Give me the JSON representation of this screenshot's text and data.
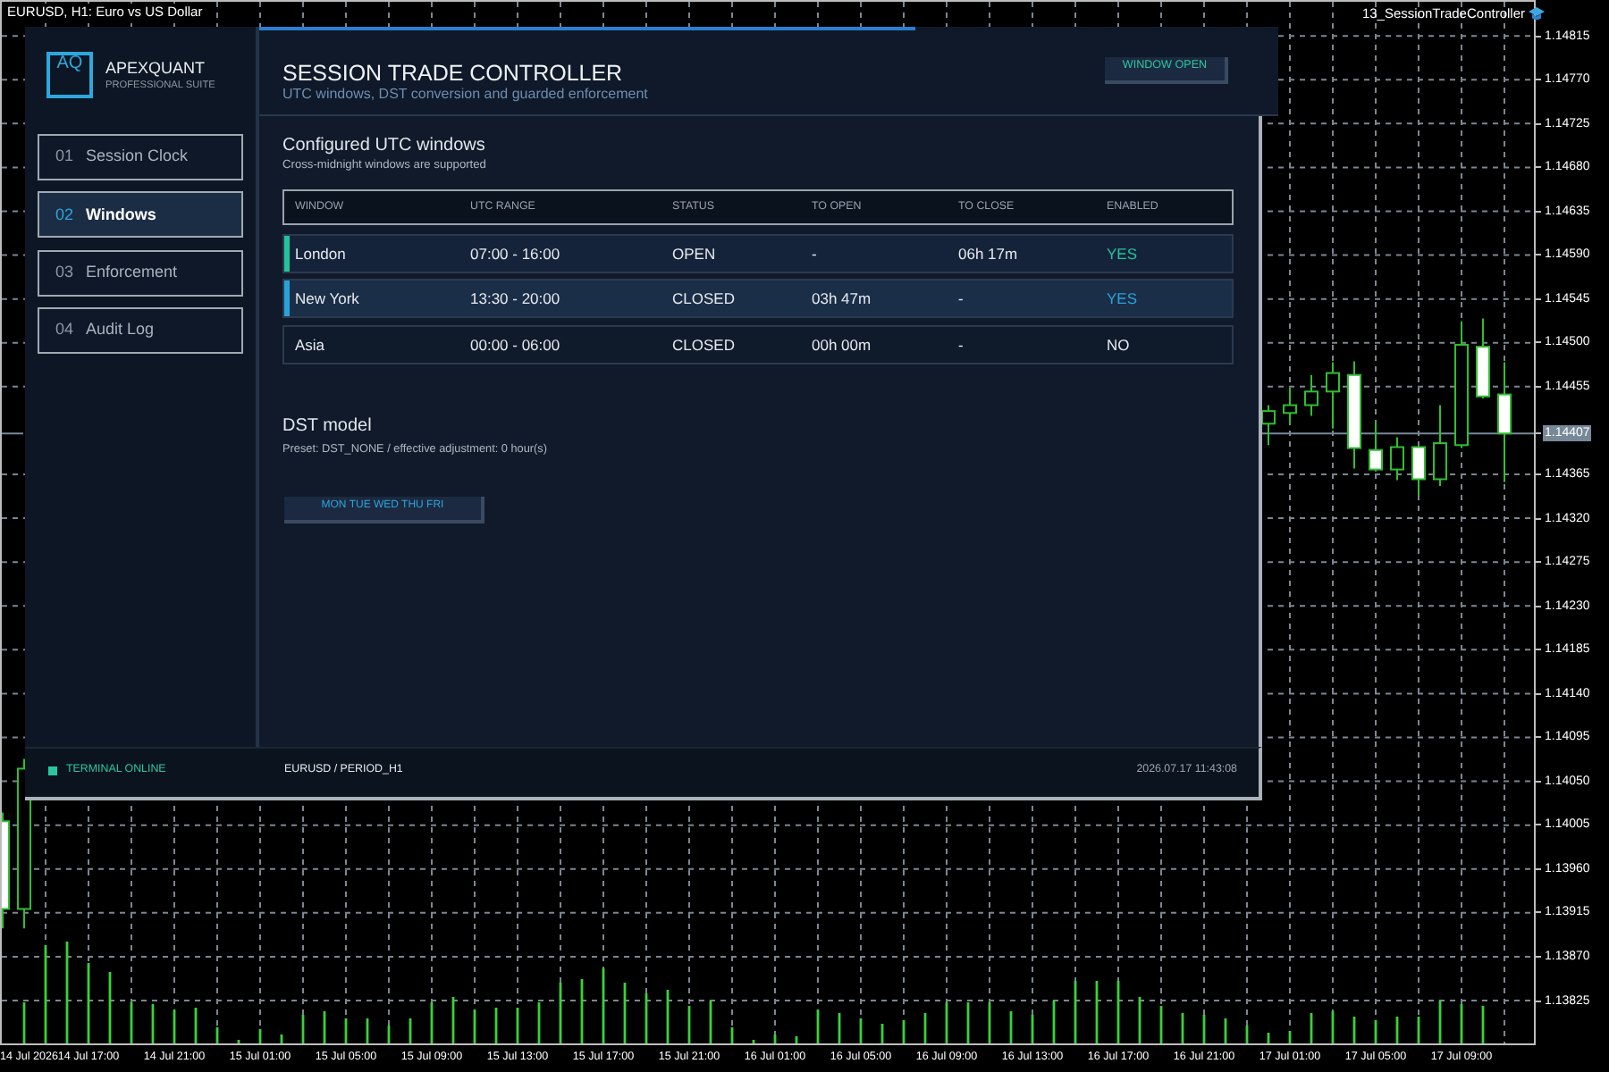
{
  "chart": {
    "title": "EURUSD, H1: Euro vs US Dollar",
    "indicator": "13_SessionTradeController",
    "chart_data": {
      "type": "candlestick",
      "grid": true,
      "categories": [
        null,
        "14 Jul 2026",
        null,
        null,
        "14 Jul 17:00",
        null,
        null,
        null,
        "14 Jul 21:00",
        null,
        null,
        null,
        "15 Jul 01:00",
        null,
        null,
        null,
        "15 Jul 05:00",
        null,
        null,
        null,
        "15 Jul 09:00",
        null,
        null,
        null,
        "15 Jul 13:00",
        null,
        null,
        null,
        "15 Jul 17:00",
        null,
        null,
        null,
        "15 Jul 21:00",
        null,
        null,
        null,
        "16 Jul 01:00",
        null,
        null,
        null,
        "16 Jul 05:00",
        null,
        null,
        null,
        "16 Jul 09:00",
        null,
        null,
        null,
        "16 Jul 13:00",
        null,
        null,
        null,
        "16 Jul 17:00",
        null,
        null,
        null,
        "16 Jul 21:00",
        null,
        null,
        null,
        "17 Jul 01:00",
        null,
        null,
        null,
        "17 Jul 05:00",
        null,
        null,
        null,
        "17 Jul 09:00",
        null,
        null
      ],
      "ohlc": [
        [
          1.14009,
          1.14018,
          1.13899,
          1.13919
        ],
        [
          1.13919,
          1.14073,
          1.13899,
          1.14063
        ],
        null,
        null,
        null,
        null,
        null,
        null,
        null,
        null,
        null,
        null,
        null,
        null,
        null,
        null,
        null,
        null,
        null,
        null,
        null,
        null,
        null,
        null,
        null,
        null,
        null,
        null,
        null,
        null,
        null,
        null,
        null,
        null,
        null,
        null,
        null,
        null,
        null,
        null,
        null,
        null,
        null,
        null,
        null,
        null,
        null,
        null,
        null,
        null,
        null,
        null,
        null,
        null,
        null,
        null,
        null,
        null,
        null,
        [
          1.14417,
          1.14436,
          1.14395,
          1.1443
        ],
        [
          1.14428,
          1.14454,
          1.14417,
          1.14436
        ],
        [
          1.14436,
          1.14467,
          1.14425,
          1.1445
        ],
        [
          1.1445,
          1.1448,
          1.14412,
          1.14469
        ],
        [
          1.14467,
          1.14481,
          1.14371,
          1.14392
        ],
        [
          1.1439,
          1.14419,
          1.14368,
          1.1437
        ],
        [
          1.1437,
          1.14403,
          1.14359,
          1.14393
        ],
        [
          1.14393,
          1.14393,
          1.14344,
          1.1436
        ],
        [
          1.1436,
          1.14436,
          1.14353,
          1.14397
        ],
        [
          1.14395,
          1.14522,
          1.14392,
          1.14498
        ],
        [
          1.14496,
          1.14525,
          1.14443,
          1.14445
        ],
        [
          1.14447,
          1.1448,
          1.14357,
          1.14407
        ]
      ],
      "ylim": [
        1.13781,
        1.1485
      ],
      "yticks": [
        {
          "value": 1.14815,
          "label": "1.14815"
        },
        {
          "value": 1.1477,
          "label": "1.14770"
        },
        {
          "value": 1.14725,
          "label": "1.14725"
        },
        {
          "value": 1.1468,
          "label": "1.14680"
        },
        {
          "value": 1.14635,
          "label": "1.14635"
        },
        {
          "value": 1.1459,
          "label": "1.14590"
        },
        {
          "value": 1.14545,
          "label": "1.14545"
        },
        {
          "value": 1.145,
          "label": "1.14500"
        },
        {
          "value": 1.14455,
          "label": "1.14455"
        },
        {
          "value": 1.14365,
          "label": "1.14365"
        },
        {
          "value": 1.1432,
          "label": "1.14320"
        },
        {
          "value": 1.14275,
          "label": "1.14275"
        },
        {
          "value": 1.1423,
          "label": "1.14230"
        },
        {
          "value": 1.14185,
          "label": "1.14185"
        },
        {
          "value": 1.1414,
          "label": "1.14140"
        },
        {
          "value": 1.14095,
          "label": "1.14095"
        },
        {
          "value": 1.1405,
          "label": "1.14050"
        },
        {
          "value": 1.14005,
          "label": "1.14005"
        },
        {
          "value": 1.1396,
          "label": "1.13960"
        },
        {
          "value": 1.13915,
          "label": "1.13915"
        },
        {
          "value": 1.1387,
          "label": "1.13870"
        },
        {
          "value": 1.13825,
          "label": "1.13825"
        }
      ],
      "ref_lines": [
        {
          "axis": "y",
          "value": 1.14407,
          "label": "1.14407"
        }
      ]
    }
  },
  "sidebar": {
    "logo": "AQ",
    "brand": "APEXQUANT",
    "tagline": "PROFESSIONAL SUITE",
    "items": [
      {
        "number": "01",
        "label": "Session Clock",
        "selected": false
      },
      {
        "number": "02",
        "label": "Windows",
        "selected": true
      },
      {
        "number": "03",
        "label": "Enforcement",
        "selected": false
      },
      {
        "number": "04",
        "label": "Audit Log",
        "selected": false
      }
    ]
  },
  "header": {
    "title": "SESSION TRADE CONTROLLER",
    "subtitle": "UTC windows, DST conversion and guarded enforcement",
    "status_button": "WINDOW OPEN"
  },
  "windows": {
    "title": "Configured UTC windows",
    "note": "Cross-midnight windows are supported",
    "columns": [
      "WINDOW",
      "UTC RANGE",
      "STATUS",
      "TO OPEN",
      "TO CLOSE",
      "ENABLED"
    ],
    "rows": [
      {
        "window": "London",
        "utc_range": "07:00 - 16:00",
        "status": "OPEN",
        "to_open": "-",
        "to_close": "06h 17m",
        "enabled": "YES",
        "selected": false,
        "color": "#22c39e"
      },
      {
        "window": "New York",
        "utc_range": "13:30 - 20:00",
        "status": "CLOSED",
        "to_open": "03h 47m",
        "to_close": "-",
        "enabled": "YES",
        "selected": true,
        "color": "#27a3dc"
      },
      {
        "window": "Asia",
        "utc_range": "00:00 - 06:00",
        "status": "CLOSED",
        "to_open": "00h 00m",
        "to_close": "-",
        "enabled": "NO",
        "selected": false
      }
    ]
  },
  "dst": {
    "title": "DST model",
    "note": "Preset: DST_NONE / effective adjustment: 0 hour(s)",
    "days_button": "MON TUE WED THU FRI"
  },
  "status_bar": {
    "connection": "TERMINAL ONLINE",
    "symbol": "EURUSD / PERIOD_H1",
    "timestamp": "2026.07.17 11:43:08"
  }
}
